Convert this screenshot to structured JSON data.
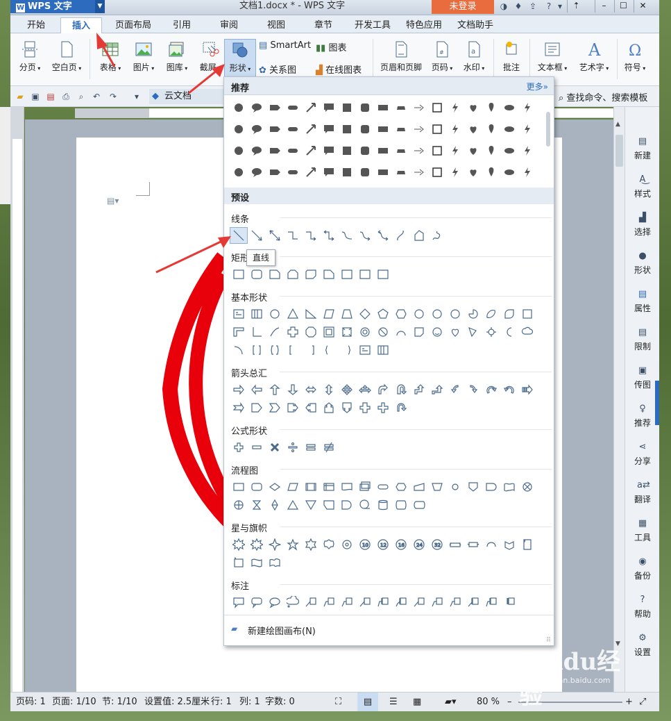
{
  "titlebar": {
    "app_name": "WPS 文字",
    "window_title": "文档1.docx * - WPS 文字",
    "login_label": "未登录"
  },
  "tabs": [
    "开始",
    "插入",
    "页面布局",
    "引用",
    "审阅",
    "视图",
    "章节",
    "开发工具",
    "特色应用",
    "文档助手"
  ],
  "active_tab": "插入",
  "ribbon": {
    "page_break": "分页",
    "blank_page": "空白页",
    "table": "表格",
    "picture": "图片",
    "gallery": "图库",
    "screenshot": "截屏",
    "shapes": "形状",
    "smartart": "SmartArt",
    "chart": "图表",
    "relation_chart": "关系图",
    "online_chart": "在线图表",
    "header_footer": "页眉和页脚",
    "page_number": "页码",
    "watermark": "水印",
    "comment": "批注",
    "text_box": "文本框",
    "word_art": "艺术字",
    "symbol": "符号"
  },
  "quickbar": {
    "cloud_doc": "云文档",
    "search_command": "查找命令、搜索模板"
  },
  "shapes_panel": {
    "recommended_title": "推荐",
    "more_label": "更多»",
    "preset_title": "预设",
    "categories": {
      "lines": "线条",
      "rectangles": "矩形",
      "basic": "基本形状",
      "arrows": "箭头总汇",
      "equation": "公式形状",
      "flowchart": "流程图",
      "stars": "星与旗帜",
      "callouts": "标注"
    },
    "tooltip": "直线",
    "new_canvas": "新建绘图画布(N)"
  },
  "right_panel": [
    "新建",
    "样式",
    "选择",
    "形状",
    "属性",
    "限制",
    "传图",
    "推荐",
    "分享",
    "翻译",
    "工具",
    "备份",
    "帮助",
    "设置"
  ],
  "statusbar": {
    "page_code": "页码: 1",
    "page": "页面: 1/10",
    "section": "节: 1/10",
    "setting": "设置值: 2.5厘米",
    "row": "行: 1",
    "col": "列: 1",
    "words": "字数: 0",
    "zoom": "80 %"
  },
  "watermark": {
    "brand": "Baidu经验",
    "url": "jingyan.baidu.com"
  },
  "colors": {
    "accent": "#2d6bbf",
    "login": "#e86c3e",
    "arc": "#e8000b",
    "arrow": "#e53935"
  }
}
